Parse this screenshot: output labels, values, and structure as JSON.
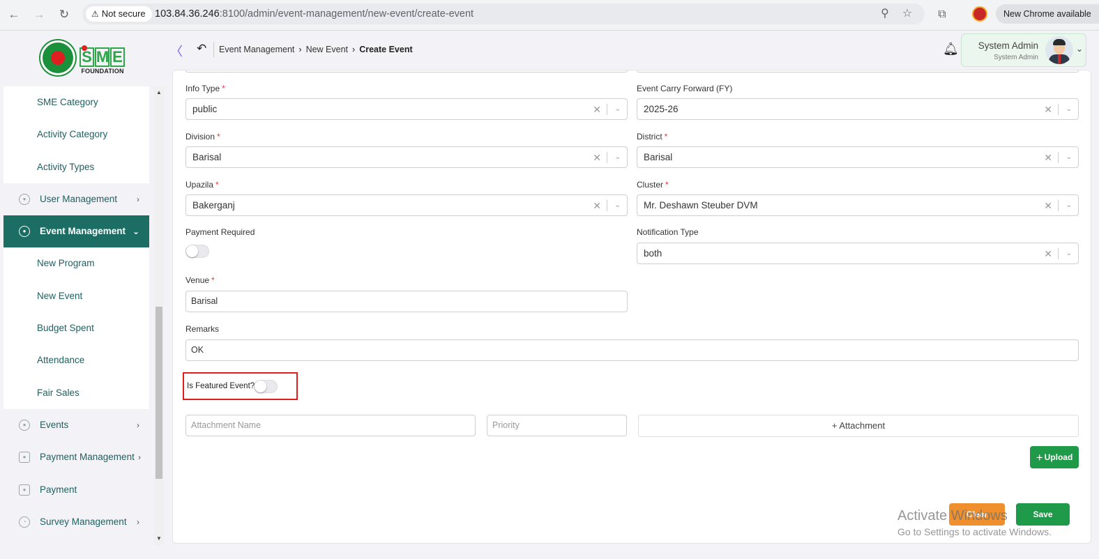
{
  "browser": {
    "security_label": "Not secure",
    "url_host": "103.84.36.246",
    "url_rest": ":8100/admin/event-management/new-event/create-event",
    "update_label": "New Chrome available",
    "icons": [
      "back-icon",
      "forward-icon",
      "reload-icon",
      "warning-icon",
      "zoom-icon",
      "bookmark-star-icon",
      "extensions-icon",
      "profile-icon"
    ]
  },
  "brand": {
    "logo_letters": [
      "S",
      "M",
      "E"
    ],
    "logo_subtitle": "FOUNDATION",
    "green": "#2da548",
    "red": "#e02020"
  },
  "sidebar": {
    "top_submenu": [
      "SME Category",
      "Activity Category",
      "Activity Types"
    ],
    "user_management": "User Management",
    "event_management": "Event Management",
    "event_submenu": [
      "New Program",
      "New Event",
      "Budget Spent",
      "Attendance",
      "Fair Sales"
    ],
    "events": "Events",
    "payment_management": "Payment Management",
    "payment": "Payment",
    "survey_management": "Survey Management",
    "active_color": "#1c6e64"
  },
  "header": {
    "breadcrumb": [
      "Event Management",
      "New Event",
      "Create Event"
    ],
    "user_name": "System Admin",
    "user_role": "System Admin"
  },
  "form": {
    "info_type": {
      "label": "Info Type",
      "value": "public",
      "required": true
    },
    "carry_forward": {
      "label": "Event Carry Forward (FY)",
      "value": "2025-26"
    },
    "division": {
      "label": "Division",
      "value": "Barisal",
      "required": true
    },
    "district": {
      "label": "District",
      "value": "Barisal",
      "required": true
    },
    "upazila": {
      "label": "Upazila",
      "value": "Bakerganj",
      "required": true
    },
    "cluster": {
      "label": "Cluster",
      "value": "Mr. Deshawn Steuber DVM",
      "required": true
    },
    "payment_required": {
      "label": "Payment Required",
      "on": false
    },
    "notification_type": {
      "label": "Notification Type",
      "value": "both"
    },
    "venue": {
      "label": "Venue",
      "value": "Barisal",
      "required": true
    },
    "remarks": {
      "label": "Remarks",
      "value": "OK"
    },
    "featured": {
      "label": "Is Featured Event?",
      "on": false
    },
    "attachment_name_placeholder": "Attachment Name",
    "priority_placeholder": "Priority",
    "attachment_button": "+ Attachment",
    "upload_button": "Upload",
    "clear_button": "Clear",
    "save_button": "Save",
    "required_mark": "*",
    "clear_glyph": "✕",
    "highlight_color": "#e21b1b"
  },
  "watermark": {
    "line1": "Activate Windows",
    "line2": "Go to Settings to activate Windows."
  }
}
